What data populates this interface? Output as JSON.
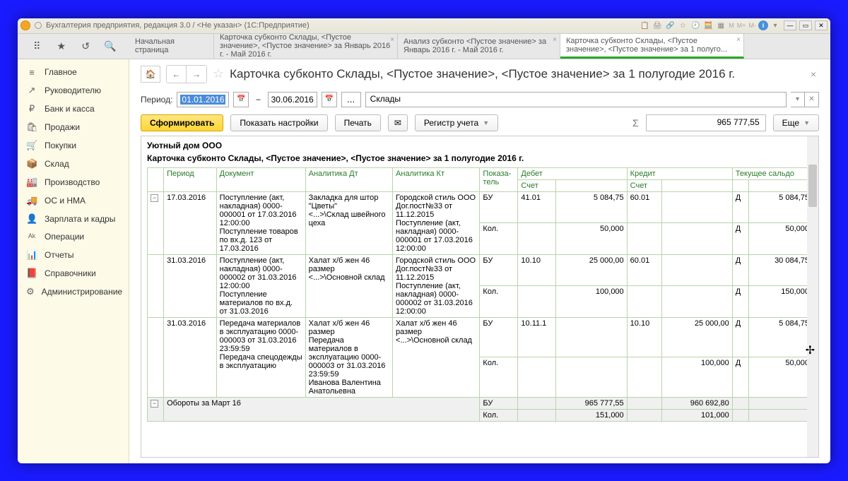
{
  "titlebar": {
    "text": "Бухгалтерия предприятия, редакция 3.0 / <Не указан>   (1С:Предприятие)",
    "m_labels": [
      "M",
      "M+",
      "M-"
    ]
  },
  "tabs": {
    "start": "Начальная страница",
    "t1": "Карточка субконто Склады, <Пустое значение>, <Пустое значение> за Январь 2016 г. - Май 2016 г.",
    "t2": "Анализ субконто <Пустое значение> за Январь 2016 г. - Май 2016 г.",
    "t3": "Карточка субконто Склады, <Пустое значение>, <Пустое значение> за 1 полуго..."
  },
  "sidebar": [
    {
      "icon": "≡",
      "label": "Главное"
    },
    {
      "icon": "↗",
      "label": "Руководителю"
    },
    {
      "icon": "₽",
      "label": "Банк и касса"
    },
    {
      "icon": "🛍",
      "label": "Продажи"
    },
    {
      "icon": "🛒",
      "label": "Покупки"
    },
    {
      "icon": "📦",
      "label": "Склад"
    },
    {
      "icon": "🏭",
      "label": "Производство"
    },
    {
      "icon": "🚚",
      "label": "ОС и НМА"
    },
    {
      "icon": "👤",
      "label": "Зарплата и кадры"
    },
    {
      "icon": "ᴬᵏ",
      "label": "Операции"
    },
    {
      "icon": "📊",
      "label": "Отчеты"
    },
    {
      "icon": "📕",
      "label": "Справочники"
    },
    {
      "icon": "⚙",
      "label": "Администрирование"
    }
  ],
  "header": {
    "title": "Карточка субконто Склады, <Пустое значение>, <Пустое значение> за 1 полугодие 2016 г."
  },
  "period": {
    "label": "Период:",
    "from": "01.01.2016",
    "to": "30.06.2016",
    "field": "Склады"
  },
  "toolbar": {
    "form": "Сформировать",
    "settings": "Показать настройки",
    "print": "Печать",
    "register": "Регистр учета",
    "more": "Еще",
    "sum": "965 777,55"
  },
  "report": {
    "org": "Уютный дом ООО",
    "title": "Карточка субконто Склады, <Пустое значение>, <Пустое значение> за 1 полугодие 2016 г.",
    "headers": {
      "period": "Период",
      "doc": "Документ",
      "anDt": "Аналитика Дт",
      "anKt": "Аналитика Кт",
      "pokaz": "Показа-\nтель",
      "debet": "Дебет",
      "credit": "Кредит",
      "saldo": "Текущее сальдо",
      "acct": "Счет"
    },
    "rows": [
      {
        "period": "17.03.2016",
        "doc": "Поступление (акт, накладная) 0000-000001 от 17.03.2016 12:00:00\nПоступление товаров по вх.д. 123 от 17.03.2016",
        "anDt": "Закладка для штор \"Цветы\"\n<...>\\Склад швейного цеха",
        "anKt": "Городской стиль ООО\nДог.пост№33 от 11.12.2015\nПоступление (акт, накладная) 0000-000001 от 17.03.2016 12:00:00",
        "lines": [
          {
            "pokaz": "БУ",
            "dAcct": "41.01",
            "dVal": "5 084,75",
            "cAcct": "60.01",
            "cVal": "",
            "sSide": "Д",
            "sVal": "5 084,75"
          },
          {
            "pokaz": "Кол.",
            "dAcct": "",
            "dVal": "50,000",
            "cAcct": "",
            "cVal": "",
            "sSide": "Д",
            "sVal": "50,000"
          }
        ]
      },
      {
        "period": "31.03.2016",
        "doc": "Поступление (акт, накладная) 0000-000002 от 31.03.2016 12:00:00\nПоступление материалов по вх.д. от 31.03.2016",
        "anDt": "Халат х/б жен 46 размер\n<...>\\Основной склад",
        "anKt": "Городской стиль ООО\nДог.пост№33 от 11.12.2015\nПоступление (акт, накладная) 0000-000002 от 31.03.2016 12:00:00",
        "lines": [
          {
            "pokaz": "БУ",
            "dAcct": "10.10",
            "dVal": "25 000,00",
            "cAcct": "60.01",
            "cVal": "",
            "sSide": "Д",
            "sVal": "30 084,75"
          },
          {
            "pokaz": "Кол.",
            "dAcct": "",
            "dVal": "100,000",
            "cAcct": "",
            "cVal": "",
            "sSide": "Д",
            "sVal": "150,000"
          }
        ]
      },
      {
        "period": "31.03.2016",
        "doc": "Передача материалов в эксплуатацию 0000-000003 от 31.03.2016 23:59:59\nПередача спецодежды в эксплуатацию",
        "anDt": "Халат х/б жен 46 размер\nПередача материалов в эксплуатацию 0000-000003 от 31.03.2016 23:59:59\nИванова Валентина Анатольевна",
        "anKt": "Халат х/б жен 46 размер\n<...>\\Основной склад",
        "lines": [
          {
            "pokaz": "БУ",
            "dAcct": "10.11.1",
            "dVal": "",
            "cAcct": "10.10",
            "cVal": "25 000,00",
            "sSide": "Д",
            "sVal": "5 084,75"
          },
          {
            "pokaz": "Кол.",
            "dAcct": "",
            "dVal": "",
            "cAcct": "",
            "cVal": "100,000",
            "sSide": "Д",
            "sVal": "50,000"
          }
        ]
      }
    ],
    "totals": {
      "label": "Обороты за Март 16",
      "lines": [
        {
          "pokaz": "БУ",
          "dVal": "965 777,55",
          "cVal": "960 692,80"
        },
        {
          "pokaz": "Кол.",
          "dVal": "151,000",
          "cVal": "101,000"
        }
      ]
    }
  }
}
